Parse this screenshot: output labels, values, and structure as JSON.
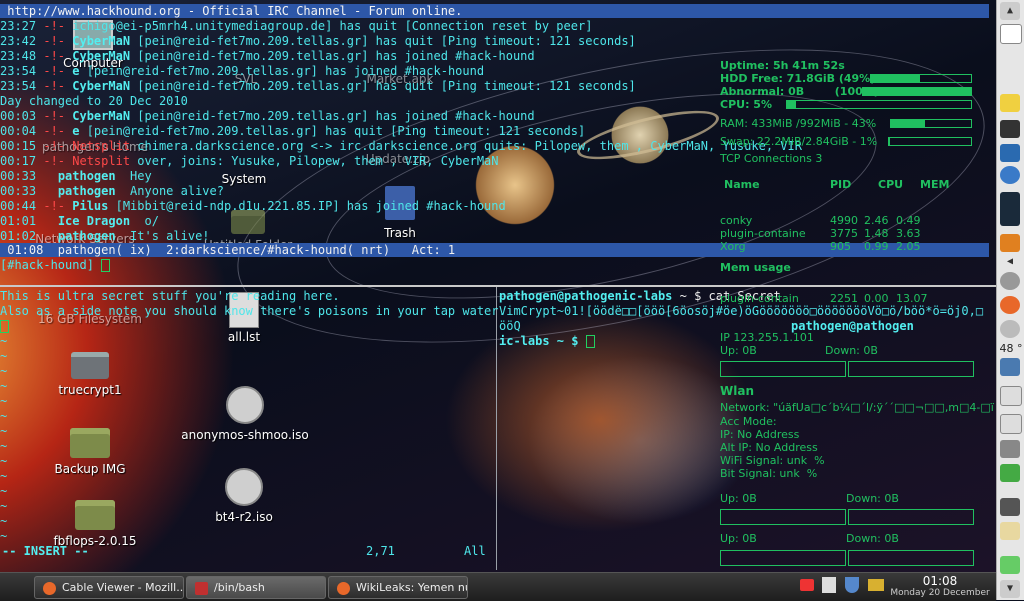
{
  "colors": {
    "accent": "#2d57a8",
    "terminal_cyan": "#4ee6ea",
    "conky_green": "#20c060",
    "alert_red": "#ff4848"
  },
  "irc": {
    "topic": " http://www.hackhound.org - Official IRC Channel - Forum online.",
    "lines": [
      {
        "t": "23:27",
        "who": "",
        "pre": " -!- ",
        "nick": "",
        "text": "ichigo@ei-p5mrh4.unitymediagroup.de] has quit [Connection reset by peer]"
      },
      {
        "t": "23:42",
        "pre": " -!- ",
        "nick": "CyberMaN",
        "text": " [pein@reid-fet7mo.209.tellas.gr] has quit [Ping timeout: 121 seconds]"
      },
      {
        "t": "23:48",
        "pre": " -!- ",
        "nick": "CyberMaN",
        "text": " [pein@reid-fet7mo.209.tellas.gr] has joined #hack-hound"
      },
      {
        "t": "23:54",
        "pre": " -!- ",
        "nick": "e",
        "text": " [pein@reid-fet7mo.209.tellas.gr] has joined #hack-hound"
      },
      {
        "t": "23:54",
        "pre": " -!- ",
        "nick": "CyberMaN",
        "text": " [pein@reid-fet7mo.209.tellas.gr] has quit [Ping timeout: 121 seconds]"
      },
      {
        "t": "",
        "pre": "",
        "nick": "",
        "text": "Day changed to 20 Dec 2010"
      },
      {
        "t": "00:03",
        "pre": " -!- ",
        "nick": "CyberMaN",
        "text": " [pein@reid-fet7mo.209.tellas.gr] has joined #hack-hound"
      },
      {
        "t": "00:04",
        "pre": " -!- ",
        "nick": "e",
        "text": " [pein@reid-fet7mo.209.tellas.gr] has quit [Ping timeout: 121 seconds]"
      },
      {
        "t": "00:15",
        "pre": " -!- ",
        "nick": "Netsplit",
        "text": " chimera.darkscience.org <-> irc.darkscience.org quits: Pilopew, them , CyberMaN, Yusuke, VIR"
      },
      {
        "t": "00:17",
        "pre": " -!- ",
        "nick": "Netsplit",
        "text": " over, joins: Yusuke, Pilopew, them , VIR, CyberMaN"
      },
      {
        "t": "00:33",
        "pre": "   ",
        "nick": "pathogen",
        "text": "  Hey"
      },
      {
        "t": "00:33",
        "pre": "   ",
        "nick": "pathogen",
        "text": "  Anyone alive?"
      },
      {
        "t": "00:44",
        "pre": " -!- ",
        "nick": "Pilus",
        "text": " [Mibbit@reid-ndp.d1u.221.85.IP] has joined #hack-hound"
      },
      {
        "t": "01:01",
        "pre": "   ",
        "nick": "Ice Dragon",
        "text": "  o/"
      },
      {
        "t": "01:02",
        "pre": "   ",
        "nick": "pathogen",
        "text": "  It's alive!"
      }
    ],
    "status": " 01:08  pathogen( ix)  2:darkscience/#hack-hound( nrt)   Act: 1",
    "input_prompt": "[#hack-hound] "
  },
  "vim": {
    "lines": [
      "This is ultra secret stuff you're reading here.",
      "Also as a side note you should know there's poisons in your tap water."
    ],
    "tilde": "~",
    "mode": "-- INSERT --",
    "position": "2,71",
    "scroll": "All"
  },
  "shell": {
    "prompt_user": "pathogen@pathogenic-labs",
    "cmd": " ~ $ cat Secret",
    "output": "VimCrypt~01![öödë□□[ööö[6öosöj#öe)öGööööööö□öööööööVö□ö/böö*ö=öj0,□ööQ\nö□□Cöa/öböwöBv□ööJêWöWöö#ösACWxöözéööööö[,1Dö[@öö□\"",
    "prompt_tail": "pathogen@pathogen",
    "line3": "ic-labs ~ $ "
  },
  "desktop_icons": [
    {
      "label": "Computer",
      "kind": "monitor"
    },
    {
      "label": "pathogen's Home",
      "kind": "folder"
    },
    {
      "label": "Network Servers",
      "kind": "network"
    },
    {
      "label": "16 GB Filesystem",
      "kind": "drive"
    },
    {
      "label": "truecrypt1",
      "kind": "drive"
    },
    {
      "label": "Backup IMG",
      "kind": "folder"
    },
    {
      "label": "fbflops-2.0.15",
      "kind": "folder"
    },
    {
      "label": "System",
      "kind": "folder"
    },
    {
      "label": "Untitled Folder",
      "kind": "folder"
    },
    {
      "label": "all.lst",
      "kind": "file"
    },
    {
      "label": "anonymos-shmoo.iso",
      "kind": "disc"
    },
    {
      "label": "bt4-r2.iso",
      "kind": "disc"
    },
    {
      "label": "Trash",
      "kind": "trash"
    },
    {
      "label": "Market.apk",
      "kind": "file"
    },
    {
      "label": "SVL",
      "kind": "file"
    },
    {
      "label": "Update.zip",
      "kind": "file"
    }
  ],
  "conky": {
    "uptime": "Uptime: 5h 41m 52s",
    "hdd": "HDD Free: 71.8GiB (49%)",
    "hdd_frac": 0.49,
    "abnormal": "Abnormal: 0B        (100%)",
    "abnormal_frac": 1.0,
    "cpu": "CPU: 5%",
    "cpu_frac": 0.05,
    "ram": "RAM: 433MiB /992MiB - 43%",
    "ram_frac": 0.43,
    "swap": "Swap: 22.2MiB/2.84GiB - 1%",
    "swap_frac": 0.01,
    "tcp": "TCP Connections 3",
    "proc_headers": [
      "Name",
      "PID",
      "CPU",
      "MEM"
    ],
    "procs": [
      [
        "conky",
        "4990",
        "2.46",
        "0.49"
      ],
      [
        "plugin-containe",
        "3775",
        "1.48",
        "3.63"
      ],
      [
        "Xorg",
        "905",
        "0.99",
        "2.05"
      ]
    ],
    "mem_usage": "Mem usage",
    "mem_proc": [
      "plugin-contain",
      "2251",
      "0.00",
      "13.07"
    ],
    "ip": "IP 123.255.1.101",
    "up1": "Up: 0B",
    "down1": "Down: 0B",
    "wlan": "Wlan",
    "network": "Network: \"úäfUa□c´b¼□´l/:ÿ´´□□¬□□,m□4-□ï",
    "acc_mode": "Acc Mode:",
    "ip_addr": "IP: No Address",
    "alt_ip": "Alt IP: No Address",
    "wifi": "WiFi Signal: unk  %",
    "bit_signal": "Bit Signal: unk  %",
    "up2": "Up: 0B",
    "down2": "Down: 0B",
    "up3": "Up: 0B",
    "down3": "Down: 0B"
  },
  "taskbar": {
    "tasks": [
      {
        "label": "Cable Viewer - Mozill...",
        "icon": "firefox-icon"
      },
      {
        "label": "/bin/bash",
        "icon": "terminal-icon"
      },
      {
        "label": "WikiLeaks: Yemen nu...",
        "icon": "firefox-icon"
      }
    ],
    "time": "01:08",
    "date": "Monday 20 December"
  },
  "right_panel": {
    "volume": "48 °"
  }
}
